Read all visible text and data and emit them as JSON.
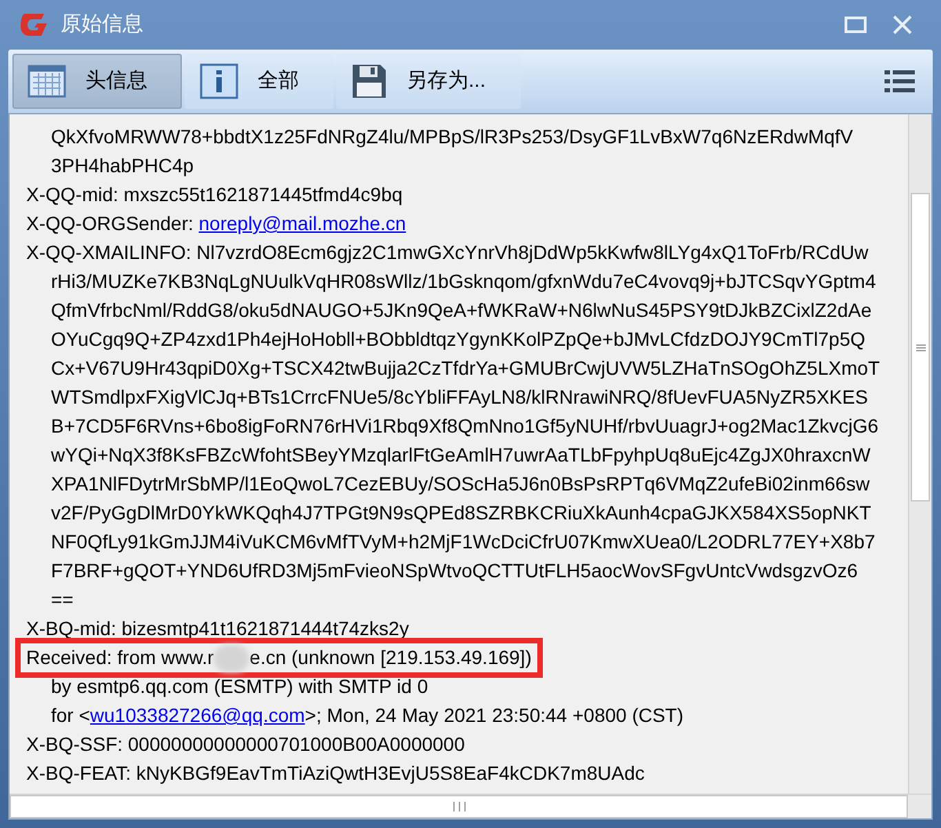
{
  "window": {
    "title": "原始信息"
  },
  "toolbar": [
    {
      "kind": "grid",
      "label": "头信息",
      "selected": true
    },
    {
      "kind": "info",
      "label": "全部",
      "selected": false
    },
    {
      "kind": "save",
      "label": "另存为...",
      "selected": false
    }
  ],
  "lines": [
    {
      "kind": "continuation",
      "segments": [
        {
          "kind": "text",
          "text": "QkXfvoMRWW78+bbdtX1z25FdNRgZ4lu/MPBpS/lR3Ps253/DsyGF1LvBxW7q6NzERdwMqfV"
        }
      ]
    },
    {
      "kind": "continuation",
      "segments": [
        {
          "kind": "text",
          "text": "3PH4habPHC4p"
        }
      ]
    },
    {
      "kind": "header",
      "segments": [
        {
          "kind": "text",
          "text": "X-QQ-mid: mxszc55t1621871445tfmd4c9bq"
        }
      ]
    },
    {
      "kind": "header",
      "segments": [
        {
          "kind": "text",
          "text": "X-QQ-ORGSender: "
        },
        {
          "kind": "link",
          "text": "noreply@mail.mozhe.cn"
        }
      ]
    },
    {
      "kind": "header",
      "segments": [
        {
          "kind": "text",
          "text": "X-QQ-XMAILINFO: Nl7vzrdO8Ecm6gjz2C1mwGXcYnrVh8jDdWp5kKwfw8lLYg4xQ1ToFrb/RCdUw"
        }
      ]
    },
    {
      "kind": "continuation",
      "segments": [
        {
          "kind": "text",
          "text": "rHi3/MUZKe7KB3NqLgNUulkVqHR08sWllz/1bGsknqom/gfxnWdu7eC4vovq9j+bJTCSqvYGptm4"
        }
      ]
    },
    {
      "kind": "continuation",
      "segments": [
        {
          "kind": "text",
          "text": "QfmVfrbcNml/RddG8/oku5dNAUGO+5JKn9QeA+fWKRaW+N6lwNuS45PSY9tDJkBZCixlZ2dAe"
        }
      ]
    },
    {
      "kind": "continuation",
      "segments": [
        {
          "kind": "text",
          "text": "OYuCgq9Q+ZP4zxd1Ph4ejHoHobll+BObbldtqzYgynKKolPZpQe+bJMvLCfdzDOJY9CmTl7p5Q"
        }
      ]
    },
    {
      "kind": "continuation",
      "segments": [
        {
          "kind": "text",
          "text": "Cx+V67U9Hr43qpiD0Xg+TSCX42twBujja2CzTfdrYa+GMUBrCwjUVW5LZHaTnSOgOhZ5LXmoT"
        }
      ]
    },
    {
      "kind": "continuation",
      "segments": [
        {
          "kind": "text",
          "text": "WTSmdlpxFXigVlCJq+BTs1CrrcFNUe5/8cYbliFFAyLN8/klRNrawiNRQ/8fUevFUA5NyZR5XKES"
        }
      ]
    },
    {
      "kind": "continuation",
      "segments": [
        {
          "kind": "text",
          "text": "B+7CD5F6RVns+6bo8igFoRN76rHVi1Rbq9Xf8QmNno1Gf5yNUHf/rbvUuagrJ+og2Mac1ZkvcjG6"
        }
      ]
    },
    {
      "kind": "continuation",
      "segments": [
        {
          "kind": "text",
          "text": "wYQi+NqX3f8KsFBZcWfohtSBeyYMzqlarlFtGeAmlH7uwrAaTLbFpyhpUq8uEjc4ZgJX0hraxcnW"
        }
      ]
    },
    {
      "kind": "continuation",
      "segments": [
        {
          "kind": "text",
          "text": "XPA1NlFDytrMrSbMP/l1EoQwoL7CezEBUy/SOScHa5J6n0BsPsRPTq6VMqZ2ufeBi02inm66sw"
        }
      ]
    },
    {
      "kind": "continuation",
      "segments": [
        {
          "kind": "text",
          "text": "v2F/PyGgDlMrD0YkWKQqh4J7TPGt9N9sQPEd8SZRBKCRiuXkAunh4cpaGJKX584XS5opNKT"
        }
      ]
    },
    {
      "kind": "continuation",
      "segments": [
        {
          "kind": "text",
          "text": "NF0QfLy91kGmJJM4iVuKCM6vMfTVyM+h2MjF1WcDciCfrU07KmwXUea0/L2ODRL77EY+X8b7"
        }
      ]
    },
    {
      "kind": "continuation",
      "segments": [
        {
          "kind": "text",
          "text": "F7BRF+gQOT+YND6UfRD3Mj5mFvieoNSpWtvoQCTTUtFLH5aocWovSFgvUntcVwdsgzvOz6"
        }
      ]
    },
    {
      "kind": "continuation",
      "segments": [
        {
          "kind": "text",
          "text": "=="
        }
      ]
    },
    {
      "kind": "header",
      "segments": [
        {
          "kind": "text",
          "text": "X-BQ-mid: bizesmtp41t1621871444t74zks2y"
        }
      ]
    },
    {
      "kind": "header",
      "highlighted": true,
      "segments": [
        {
          "kind": "text",
          "text": "Received: from www.r"
        },
        {
          "kind": "redacted"
        },
        {
          "kind": "text",
          "text": "e.cn (unknown [219.153.49.169])"
        }
      ]
    },
    {
      "kind": "continuation",
      "segments": [
        {
          "kind": "text",
          "text": "by esmtp6.qq.com (ESMTP) with SMTP id 0"
        }
      ]
    },
    {
      "kind": "continuation",
      "segments": [
        {
          "kind": "text",
          "text": "for <"
        },
        {
          "kind": "link",
          "text": "wu1033827266@qq.com"
        },
        {
          "kind": "text",
          "text": ">; Mon, 24 May 2021 23:50:44 +0800 (CST)"
        }
      ]
    },
    {
      "kind": "header",
      "segments": [
        {
          "kind": "text",
          "text": "X-BQ-SSF: 00000000000000701000B00A0000000"
        }
      ]
    },
    {
      "kind": "header",
      "segments": [
        {
          "kind": "text",
          "text": "X-BQ-FEAT: kNyKBGf9EavTmTiAziQwtH3EvjU5S8EaF4kCDK7m8UAdc"
        }
      ]
    }
  ]
}
